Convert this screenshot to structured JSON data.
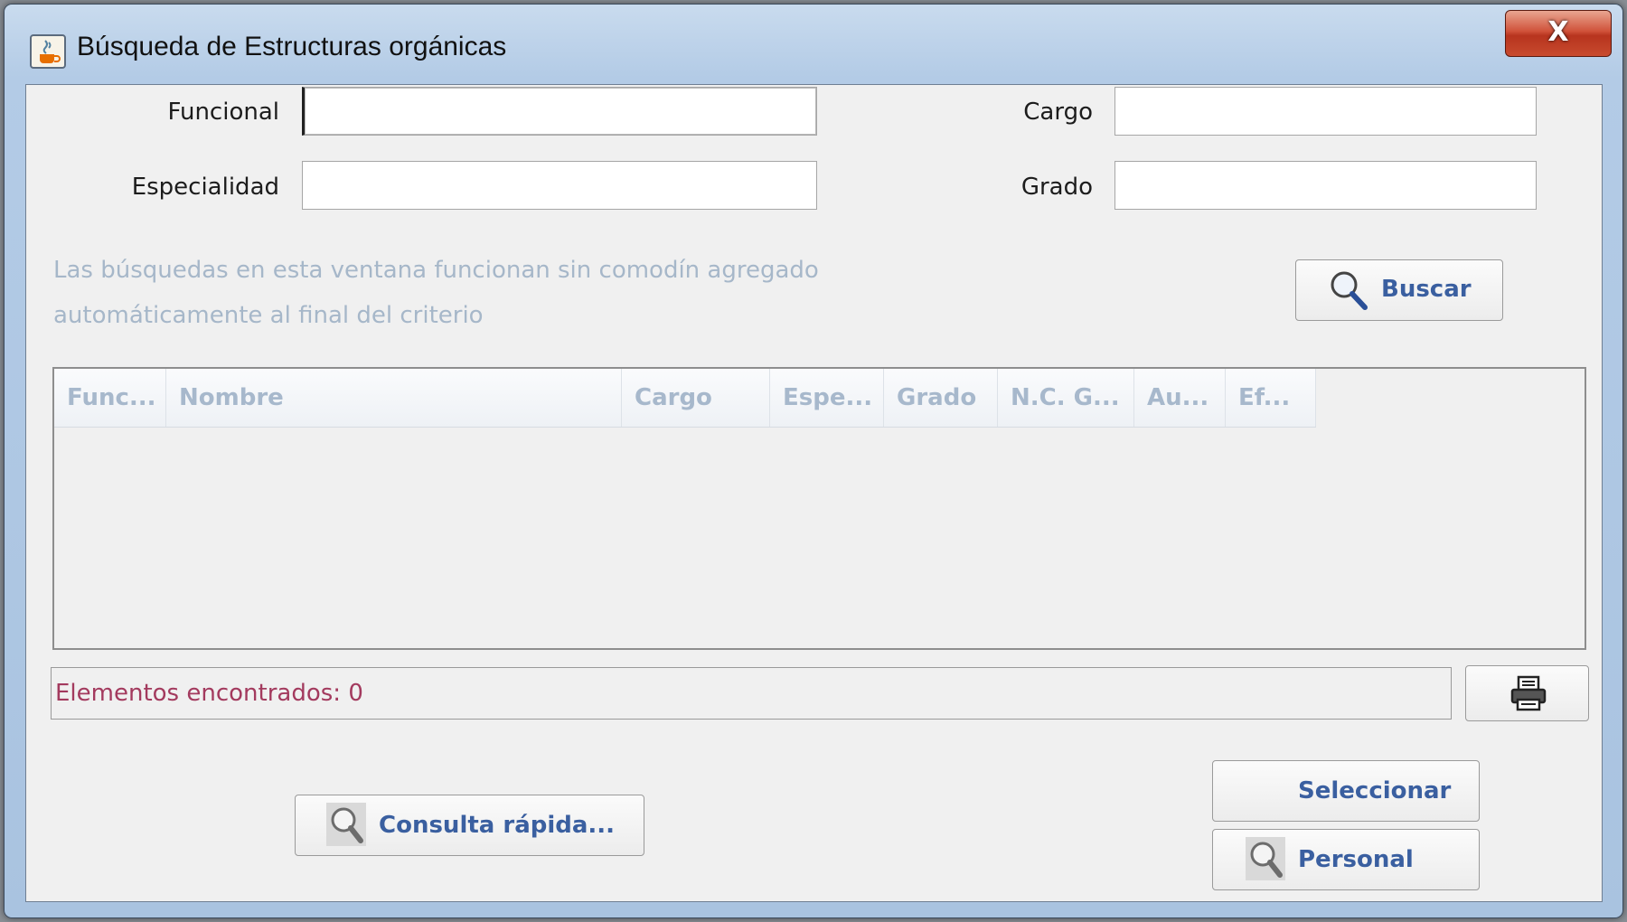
{
  "window": {
    "title": "Búsqueda de Estructuras orgánicas",
    "app_icon": "java-cup-icon",
    "close_label": "X"
  },
  "form": {
    "funcional": {
      "label": "Funcional",
      "value": ""
    },
    "cargo": {
      "label": "Cargo",
      "value": ""
    },
    "especialidad": {
      "label": "Especialidad",
      "value": ""
    },
    "grado": {
      "label": "Grado",
      "value": ""
    }
  },
  "hint_lines": [
    "Las búsquedas en esta ventana funcionan sin comodín agregado",
    "automáticamente al final del criterio"
  ],
  "buttons": {
    "buscar": "Buscar",
    "consulta_rapida": "Consulta rápida...",
    "seleccionar": "Seleccionar",
    "personal": "Personal",
    "print_icon": "printer-icon",
    "search_icon": "magnifier-icon"
  },
  "table": {
    "columns": [
      "Func...",
      "Nombre",
      "Cargo",
      "Espe...",
      "Grado",
      "N.C. G...",
      "Au...",
      "Ef..."
    ],
    "rows": []
  },
  "status": {
    "text": "Elementos encontrados: 0"
  },
  "colors": {
    "accent_text": "#3a5fa0",
    "status_text": "#a33a5e",
    "hint_text": "#a6b7c9",
    "close_button": "#c84a2e"
  }
}
